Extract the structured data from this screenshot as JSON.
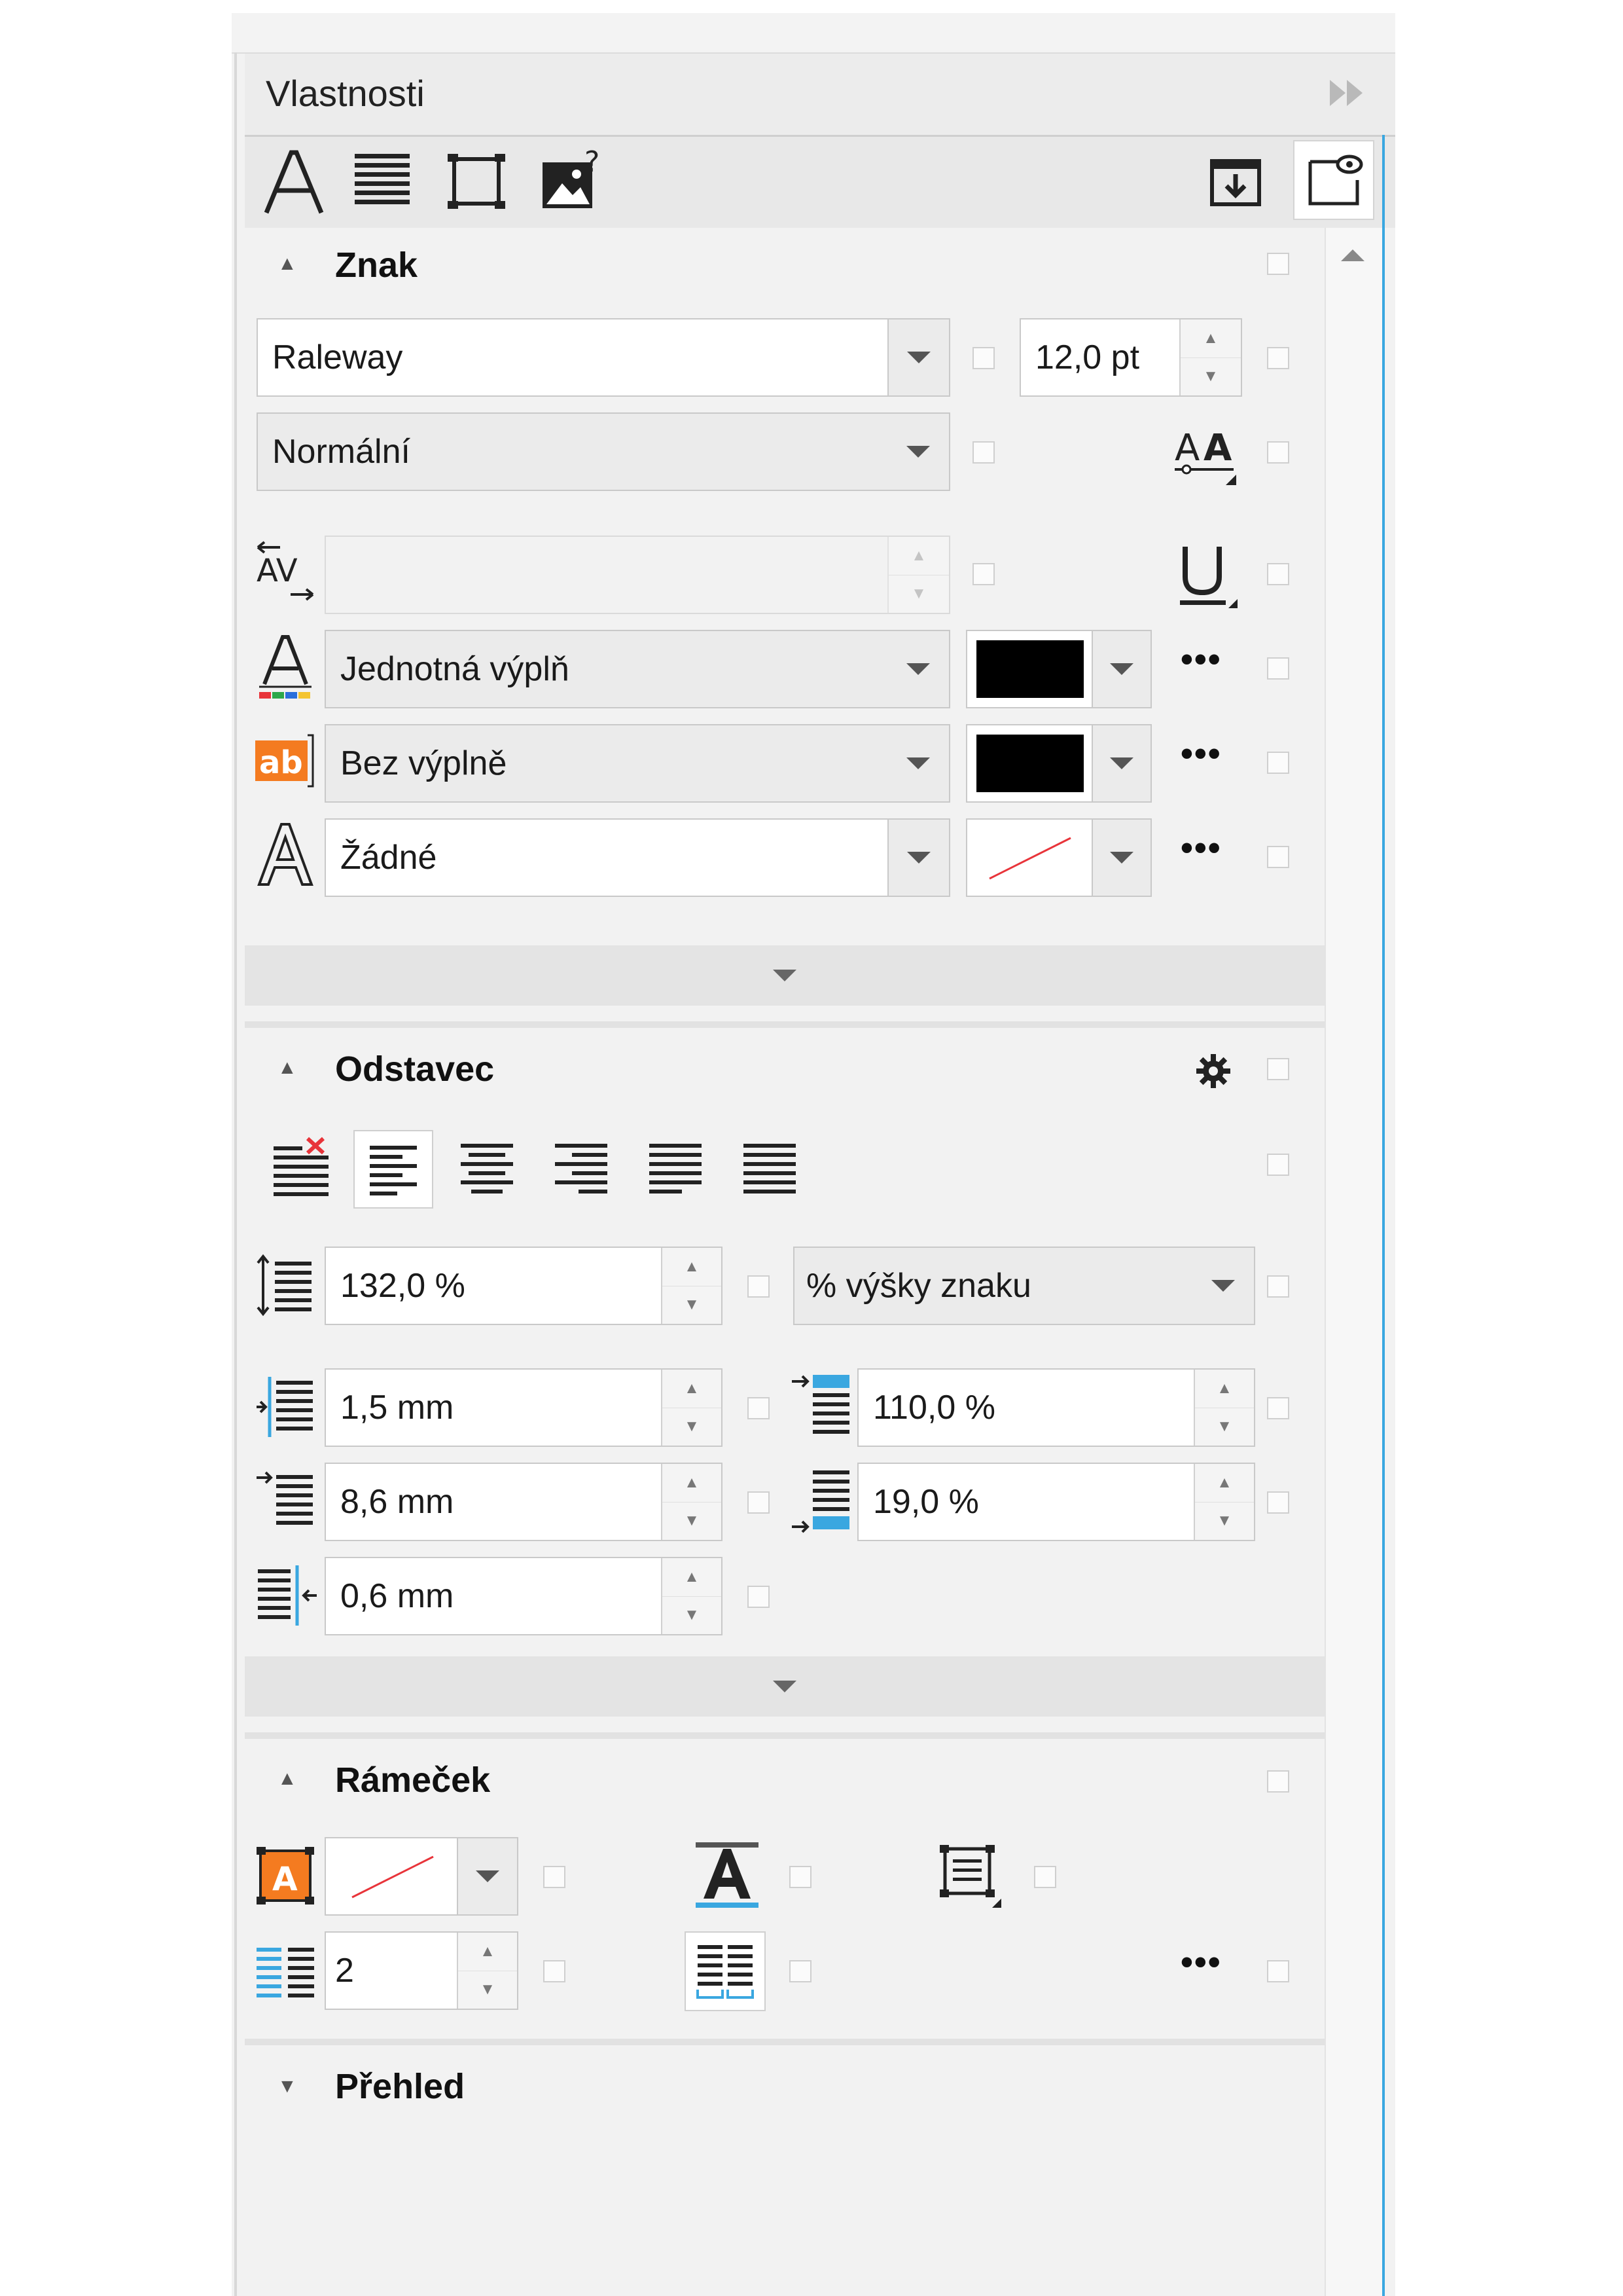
{
  "panel": {
    "title": "Vlastnosti"
  },
  "toolbar": {
    "tabs": [
      "character-tab",
      "paragraph-tab",
      "frame-tab",
      "graphic-tab"
    ],
    "right_buttons": [
      "apply-to-all-icon",
      "preview-toggle-icon"
    ]
  },
  "sections": {
    "znak": {
      "title": "Znak",
      "font_family": "Raleway",
      "font_size": "12,0 pt",
      "font_style": "Normální",
      "kerning": "",
      "fill_type": "Jednotná výplň",
      "fill_color": "#000000",
      "background_fill_type": "Bez výplně",
      "background_fill_color": "#000000",
      "outline_type": "Žádné"
    },
    "odstavec": {
      "title": "Odstavec",
      "line_spacing": "132,0 %",
      "line_spacing_unit": "% výšky znaku",
      "left_indent": "1,5 mm",
      "space_before": "110,0 %",
      "first_line_indent": "8,6 mm",
      "space_after": "19,0 %",
      "right_indent": "0,6 mm"
    },
    "ramecek": {
      "title": "Rámeček",
      "columns": "2"
    },
    "prehled": {
      "title": "Přehled"
    }
  },
  "colors": {
    "panel_bg": "#f2f2f2",
    "accent_blue": "#3aa7e0",
    "orange": "#f47b20",
    "none_line": "#e8343a"
  }
}
